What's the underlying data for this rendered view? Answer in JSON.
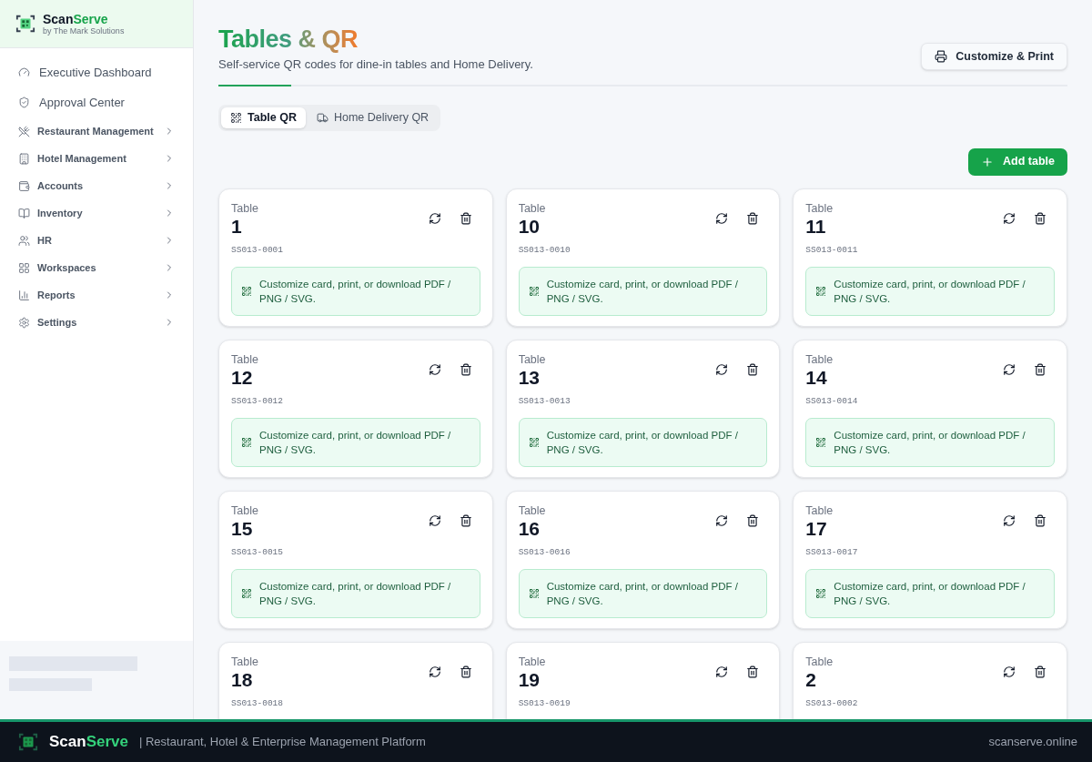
{
  "brand": {
    "name_a": "Scan",
    "name_b": "Serve",
    "byline": "by The Mark Solutions"
  },
  "sidebar": {
    "items": [
      {
        "kind": "link",
        "label": "Executive Dashboard"
      },
      {
        "kind": "link",
        "label": "Approval Center"
      },
      {
        "kind": "group",
        "label": "Restaurant Management"
      },
      {
        "kind": "group",
        "label": "Hotel Management"
      },
      {
        "kind": "group",
        "label": "Accounts"
      },
      {
        "kind": "group",
        "label": "Inventory"
      },
      {
        "kind": "group",
        "label": "HR"
      },
      {
        "kind": "group",
        "label": "Workspaces"
      },
      {
        "kind": "group",
        "label": "Reports"
      },
      {
        "kind": "group",
        "label": "Settings"
      }
    ]
  },
  "header": {
    "title": "Tables & QR",
    "subtitle": "Self-service QR codes for dine-in tables and Home Delivery.",
    "print_button": "Customize & Print"
  },
  "tabs": [
    {
      "label": "Table QR",
      "selected": true
    },
    {
      "label": "Home Delivery QR",
      "selected": false
    }
  ],
  "add_button": "Add table",
  "tables": [
    {
      "caption": "Table",
      "number": "1",
      "code": "SS013-0001",
      "hint": "Customize card, print, or download PDF / PNG / SVG."
    },
    {
      "caption": "Table",
      "number": "10",
      "code": "SS013-0010",
      "hint": "Customize card, print, or download PDF / PNG / SVG."
    },
    {
      "caption": "Table",
      "number": "11",
      "code": "SS013-0011",
      "hint": "Customize card, print, or download PDF / PNG / SVG."
    },
    {
      "caption": "Table",
      "number": "12",
      "code": "SS013-0012",
      "hint": "Customize card, print, or download PDF / PNG / SVG."
    },
    {
      "caption": "Table",
      "number": "13",
      "code": "SS013-0013",
      "hint": "Customize card, print, or download PDF / PNG / SVG."
    },
    {
      "caption": "Table",
      "number": "14",
      "code": "SS013-0014",
      "hint": "Customize card, print, or download PDF / PNG / SVG."
    },
    {
      "caption": "Table",
      "number": "15",
      "code": "SS013-0015",
      "hint": "Customize card, print, or download PDF / PNG / SVG."
    },
    {
      "caption": "Table",
      "number": "16",
      "code": "SS013-0016",
      "hint": "Customize card, print, or download PDF / PNG / SVG."
    },
    {
      "caption": "Table",
      "number": "17",
      "code": "SS013-0017",
      "hint": "Customize card, print, or download PDF / PNG / SVG."
    },
    {
      "caption": "Table",
      "number": "18",
      "code": "SS013-0018"
    },
    {
      "caption": "Table",
      "number": "19",
      "code": "SS013-0019"
    },
    {
      "caption": "Table",
      "number": "2",
      "code": "SS013-0002"
    }
  ],
  "footer": {
    "brand_a": "Scan",
    "brand_b": "Serve",
    "tagline": "| Restaurant, Hotel & Enterprise Management Platform",
    "site": "scanserve.online"
  }
}
